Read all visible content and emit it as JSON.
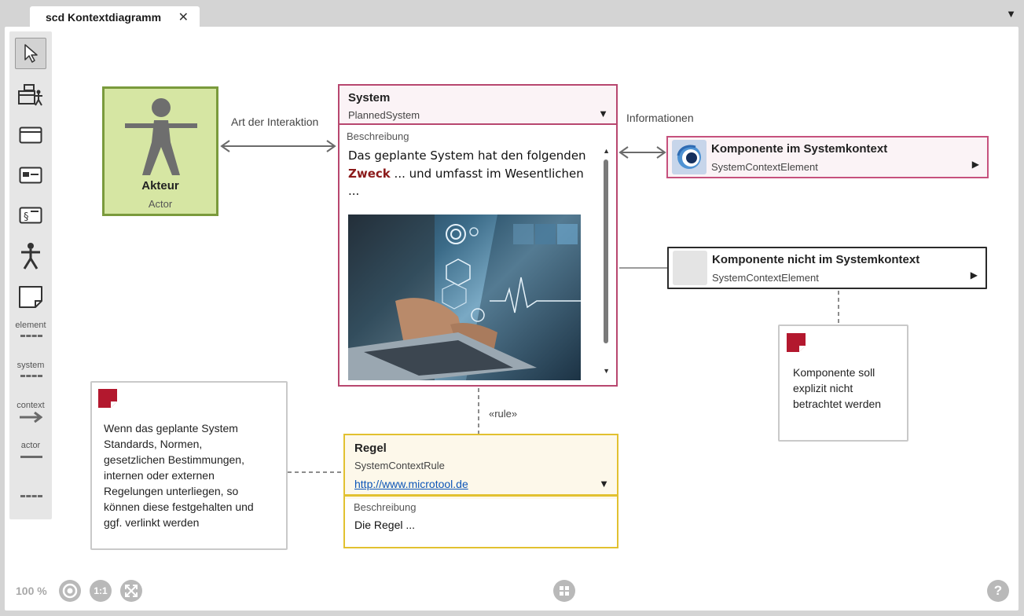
{
  "tab": {
    "title": "scd Kontextdiagramm",
    "close_glyph": "✕",
    "menu_glyph": "▼"
  },
  "palette": {
    "items": [
      {
        "icon": "pointer-icon"
      },
      {
        "icon": "context-diagram-icon"
      },
      {
        "icon": "window-icon"
      },
      {
        "icon": "element-card-icon"
      },
      {
        "icon": "section-card-icon"
      },
      {
        "icon": "actor-icon"
      },
      {
        "icon": "note-icon"
      }
    ],
    "labels": {
      "element": "element",
      "system": "system",
      "context": "context",
      "actor": "actor"
    }
  },
  "actor": {
    "name": "Akteur",
    "type": "Actor",
    "color": "#d6e6a3",
    "border": "#7a9a3c"
  },
  "connections": {
    "interaction_label": "Art der Interaktion",
    "info_label": "Informationen",
    "rule_label": "«rule»"
  },
  "system": {
    "title": "System",
    "type": "PlannedSystem",
    "dropdown_glyph": "▼",
    "desc_label": "Beschreibung",
    "desc_part1": "Das geplante System hat den folgenden ",
    "desc_highlight": "Zweck",
    "desc_part2": " ... und umfasst im Wesentlichen ...",
    "scroll_up": "▲",
    "scroll_down": "▼",
    "border": "#b8476f"
  },
  "components": [
    {
      "title": "Komponente im Systemkontext",
      "type": "SystemContextElement",
      "arrow": "▶",
      "icon": "context-element-icon",
      "border": "#c6517d"
    },
    {
      "title": "Komponente nicht im Systemkontext",
      "type": "SystemContextElement",
      "arrow": "▶",
      "icon": "empty-element-icon",
      "border": "#2a2a2a"
    }
  ],
  "notes": [
    {
      "text": "Komponente soll\nexplizit nicht\nbetrachtet werden"
    },
    {
      "text": "Wenn das geplante System\nStandards, Normen,\ngesetzlichen Bestimmungen,\ninternen oder externen\nRegelungen unterliegen, so\nkönnen diese  festgehalten und\nggf. verlinkt werden"
    }
  ],
  "rule": {
    "title": "Regel",
    "type": "SystemContextRule",
    "link": "http://www.microtool.de",
    "dropdown_glyph": "▼",
    "desc_label": "Beschreibung",
    "desc": "Die Regel ...",
    "border": "#e2c130"
  },
  "bottom": {
    "zoom": "100 %",
    "one_to_one": "1:1",
    "help": "?"
  }
}
